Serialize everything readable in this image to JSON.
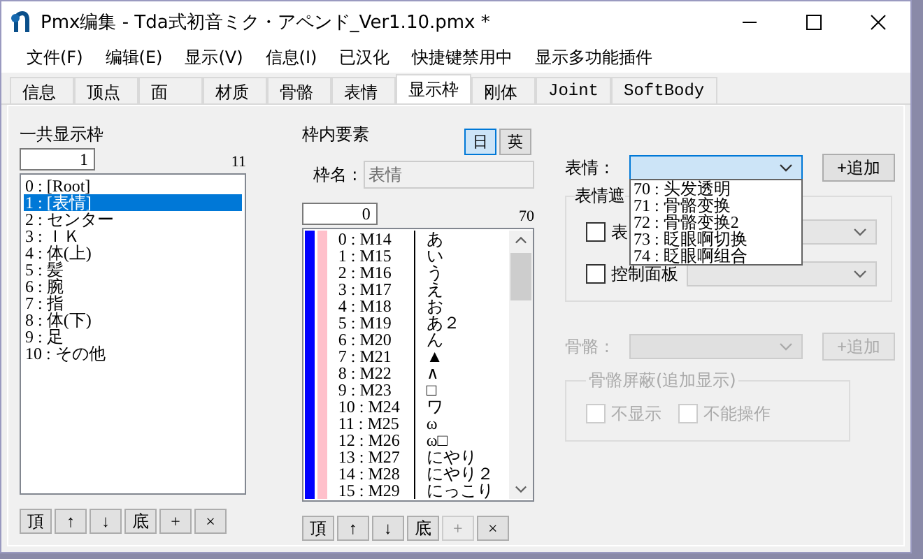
{
  "window": {
    "title": "Pmx编集 - Tda式初音ミク・アペンド_Ver1.10.pmx *"
  },
  "menu": [
    "文件(F)",
    "编辑(E)",
    "显示(V)",
    "信息(I)",
    "已汉化",
    "快捷键禁用中",
    "显示多功能插件"
  ],
  "tabs": [
    {
      "label": "信息",
      "selected": false
    },
    {
      "label": "顶点",
      "selected": false
    },
    {
      "label": "面",
      "selected": false
    },
    {
      "label": "材质",
      "selected": false
    },
    {
      "label": "骨骼",
      "selected": false
    },
    {
      "label": "表情",
      "selected": false
    },
    {
      "label": "显示枠",
      "selected": true
    },
    {
      "label": "刚体",
      "selected": false
    },
    {
      "label": "Joint",
      "selected": false
    },
    {
      "label": "SoftBody",
      "selected": false
    }
  ],
  "frames": {
    "heading": "一共显示枠",
    "index": "1",
    "count": "11",
    "items": [
      {
        "label": "0 : [Root]",
        "selected": false
      },
      {
        "label": "1 : [表情]",
        "selected": true
      },
      {
        "label": "2 : センター",
        "selected": false
      },
      {
        "label": "3 : ＩＫ",
        "selected": false
      },
      {
        "label": "4 : 体(上)",
        "selected": false
      },
      {
        "label": "5 : 髪",
        "selected": false
      },
      {
        "label": "6 : 腕",
        "selected": false
      },
      {
        "label": "7 : 指",
        "selected": false
      },
      {
        "label": "8 : 体(下)",
        "selected": false
      },
      {
        "label": "9 : 足",
        "selected": false
      },
      {
        "label": "10 : その他",
        "selected": false
      }
    ],
    "buttons": [
      {
        "label": "頂",
        "disabled": false
      },
      {
        "label": "↑",
        "disabled": false
      },
      {
        "label": "↓",
        "disabled": false
      },
      {
        "label": "底",
        "disabled": false
      },
      {
        "label": "+",
        "disabled": false
      },
      {
        "label": "×",
        "disabled": false
      }
    ]
  },
  "elements": {
    "heading": "枠内要素",
    "languages": [
      {
        "label": "日",
        "selected": true
      },
      {
        "label": "英",
        "selected": false
      }
    ],
    "name_label": "枠名 :",
    "name_value": "表情",
    "index": "0",
    "count": "70",
    "rows": [
      {
        "key": "0 : M14",
        "name": "あ"
      },
      {
        "key": "1 : M15",
        "name": "い"
      },
      {
        "key": "2 : M16",
        "name": "う"
      },
      {
        "key": "3 : M17",
        "name": "え"
      },
      {
        "key": "4 : M18",
        "name": "お"
      },
      {
        "key": "5 : M19",
        "name": "あ２"
      },
      {
        "key": "6 : M20",
        "name": "ん"
      },
      {
        "key": "7 : M21",
        "name": "▲"
      },
      {
        "key": "8 : M22",
        "name": "∧"
      },
      {
        "key": "9 : M23",
        "name": "□"
      },
      {
        "key": "10 : M24",
        "name": "ワ"
      },
      {
        "key": "11 : M25",
        "name": "ω"
      },
      {
        "key": "12 : M26",
        "name": "ω□"
      },
      {
        "key": "13 : M27",
        "name": "にやり"
      },
      {
        "key": "14 : M28",
        "name": "にやり２"
      },
      {
        "key": "15 : M29",
        "name": "にっこり"
      }
    ],
    "buttons": [
      {
        "label": "頂",
        "disabled": false
      },
      {
        "label": "↑",
        "disabled": false
      },
      {
        "label": "↓",
        "disabled": false
      },
      {
        "label": "底",
        "disabled": false
      },
      {
        "label": "+",
        "disabled": true
      },
      {
        "label": "×",
        "disabled": false
      }
    ]
  },
  "morph": {
    "label": "表情 :",
    "add": "+追加",
    "options": [
      "70 : 头发透明",
      "71 : 骨骼变换",
      "72 : 骨骼变换2",
      "73 : 眨眼啊切换",
      "74 : 眨眼啊组合"
    ],
    "mask": {
      "title": "表情遮",
      "checks": [
        {
          "label": "表",
          "checked": false
        },
        {
          "label": "控制面板",
          "checked": false
        }
      ]
    }
  },
  "bone": {
    "label": "骨骼 :",
    "add": "+追加",
    "disabled": true,
    "mask": {
      "title": "骨骼屏蔽(追加显示)",
      "checks": [
        {
          "label": "不显示",
          "checked": false
        },
        {
          "label": "不能操作",
          "checked": false
        }
      ]
    }
  }
}
